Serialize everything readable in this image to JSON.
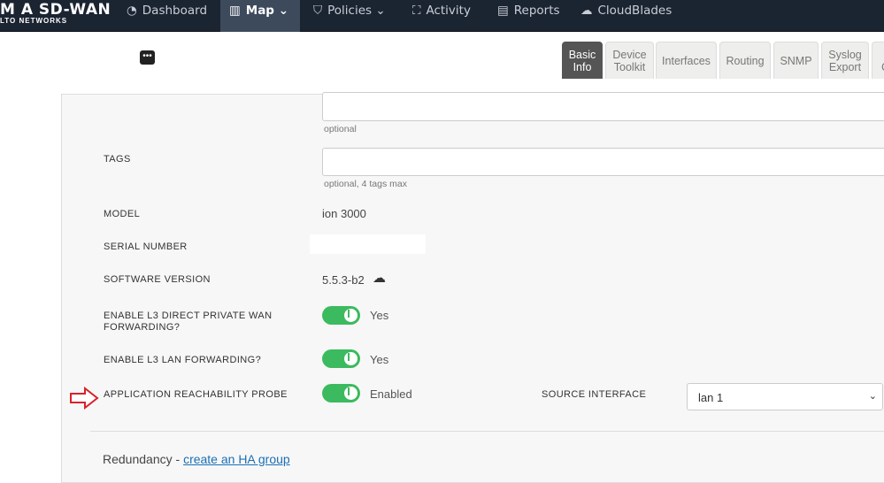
{
  "brand": {
    "line1": "M A SD-WAN",
    "line2": "LTO NETWORKS"
  },
  "nav": [
    {
      "label": "Dashboard",
      "icon": "dashboard-icon"
    },
    {
      "label": "Map",
      "icon": "map-icon"
    },
    {
      "label": "Policies",
      "icon": "shield-icon"
    },
    {
      "label": "Activity",
      "icon": "binoculars-icon"
    },
    {
      "label": "Reports",
      "icon": "file-icon"
    },
    {
      "label": "CloudBlades",
      "icon": "cloud-icon"
    }
  ],
  "more": "•••",
  "tabs": [
    {
      "l1": "Basic",
      "l2": "Info"
    },
    {
      "l1": "Device",
      "l2": "Toolkit"
    },
    {
      "l1": "Interfaces",
      "l2": ""
    },
    {
      "l1": "Routing",
      "l2": ""
    },
    {
      "l1": "SNMP",
      "l2": ""
    },
    {
      "l1": "Syslog",
      "l2": "Export"
    },
    {
      "l1": "I",
      "l2": "C"
    }
  ],
  "form": {
    "hint1": "optional",
    "tags_label": "TAGS",
    "tags_hint": "optional, 4 tags max",
    "model_label": "MODEL",
    "model": "ion 3000",
    "serial_label": "SERIAL NUMBER",
    "sw_label": "SOFTWARE VERSION",
    "sw": "5.5.3-b2",
    "l3wan_label": "ENABLE L3 DIRECT PRIVATE WAN FORWARDING?",
    "l3wan": "Yes",
    "l3lan_label": "ENABLE L3 LAN FORWARDING?",
    "l3lan": "Yes",
    "probe_label": "APPLICATION REACHABILITY PROBE",
    "probe": "Enabled",
    "src_label": "SOURCE INTERFACE",
    "src": "lan 1"
  },
  "redundancy": {
    "text": "Redundancy - ",
    "link": "create an HA group"
  }
}
